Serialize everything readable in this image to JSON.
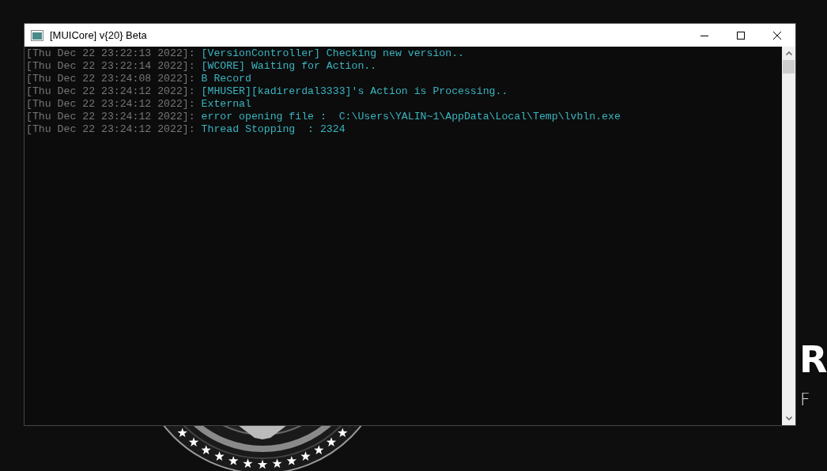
{
  "backdrop": {
    "heading_fragment": "R",
    "subheading_fragment": "F"
  },
  "window": {
    "title": "[MUICore] v{20} Beta"
  },
  "console": {
    "lines": [
      {
        "timestamp": "[Thu Dec 22 23:22:13 2022]:",
        "message": "[VersionController] Checking new version.."
      },
      {
        "timestamp": "[Thu Dec 22 23:22:14 2022]:",
        "message": "[WCORE] Waiting for Action.."
      },
      {
        "timestamp": "[Thu Dec 22 23:24:08 2022]:",
        "message": "B Record"
      },
      {
        "timestamp": "[Thu Dec 22 23:24:12 2022]:",
        "message": "[MHUSER][kadirerdal3333]'s Action is Processing.."
      },
      {
        "timestamp": "[Thu Dec 22 23:24:12 2022]:",
        "message": "External"
      },
      {
        "timestamp": "[Thu Dec 22 23:24:12 2022]:",
        "message": "error opening file :  C:\\Users\\YALIN~1\\AppData\\Local\\Temp\\lvbln.exe"
      },
      {
        "timestamp": "[Thu Dec 22 23:24:12 2022]:",
        "message": "Thread Stopping  : 2324"
      }
    ]
  }
}
